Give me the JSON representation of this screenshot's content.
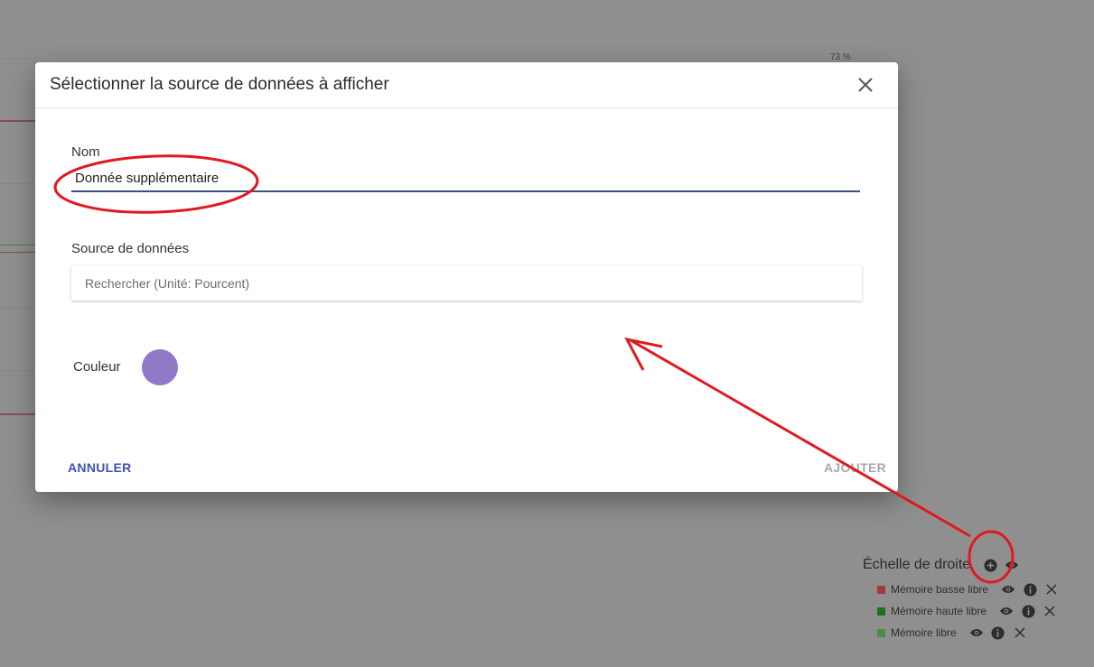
{
  "dialog": {
    "title": "Sélectionner la source de données à afficher",
    "name_label": "Nom",
    "name_value": "Donnée supplémentaire",
    "source_label": "Source de données",
    "search_placeholder": "Rechercher (Unité: Pourcent)",
    "color_label": "Couleur",
    "color_value": "#9079c6",
    "cancel_label": "ANNULER",
    "add_label": "AJOUTER"
  },
  "background": {
    "percent_label": "73 %"
  },
  "legend": {
    "title": "Échelle de droite",
    "items": [
      {
        "label": "Mémoire basse libre",
        "color": "#a13a3a"
      },
      {
        "label": "Mémoire haute libre",
        "color": "#1f6f23"
      },
      {
        "label": "Mémoire libre",
        "color": "#4c8a4e"
      }
    ]
  },
  "colors": {
    "accent": "#3f51b5",
    "annotation": "#e0191f"
  }
}
